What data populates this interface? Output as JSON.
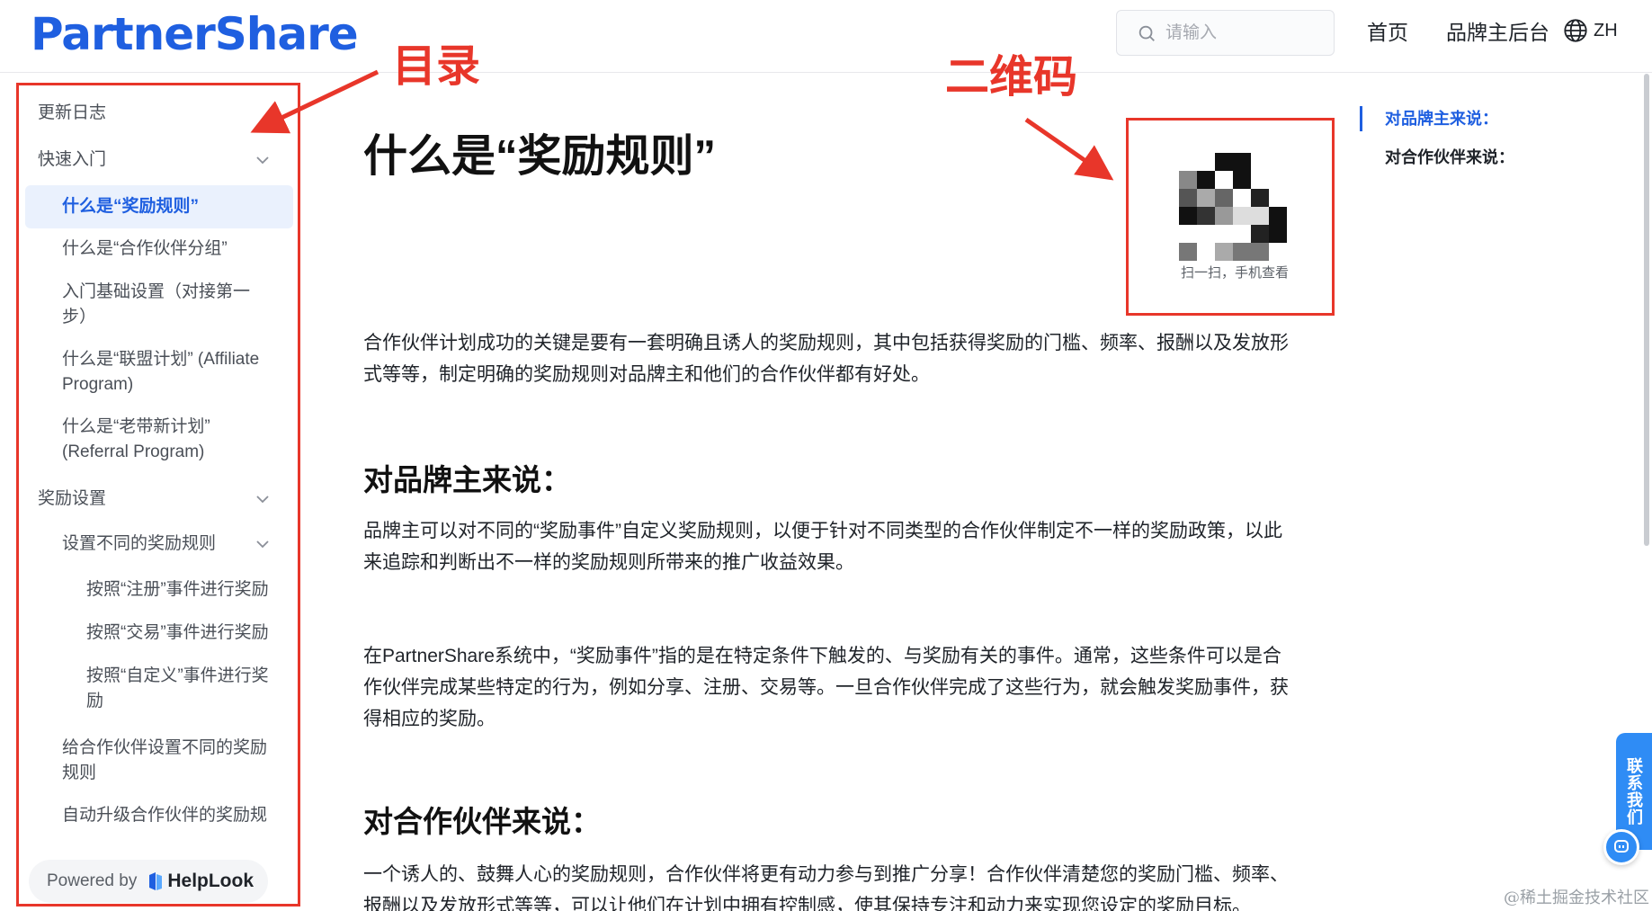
{
  "header": {
    "logo": "PartnerShare",
    "search_placeholder": "请输入",
    "nav": [
      "首页",
      "品牌主后台"
    ],
    "lang": "ZH"
  },
  "sidebar": {
    "items": [
      "更新日志",
      "快速入门",
      "什么是“奖励规则”",
      "什么是“合作伙伴分组”",
      "入门基础设置（对接第一步）",
      "什么是“联盟计划” (Affiliate Program)",
      "什么是“老带新计划” (Referral Program)",
      "奖励设置",
      "设置不同的奖励规则",
      "按照“注册”事件进行奖励",
      "按照“交易”事件进行奖励",
      "按照“自定义”事件进行奖励",
      "给合作伙伴设置不同的奖励规则",
      "自动升级合作伙伴的奖励规则"
    ],
    "active_index": 2,
    "powered_by": "Powered by",
    "powered_brand": "HelpLook"
  },
  "annotations": {
    "toc_label": "目录",
    "qr_label": "二维码"
  },
  "main": {
    "title": "什么是“奖励规则”",
    "qr_caption": "扫一扫，手机查看",
    "intro": "合作伙伴计划成功的关键是要有一套明确且诱人的奖励规则，其中包括获得奖励的门槛、频率、报酬以及发放形式等等，制定明确的奖励规则对品牌主和他们的合作伙伴都有好处。",
    "section1_heading": "对品牌主来说：",
    "section1_p1": "品牌主可以对不同的“奖励事件”自定义奖励规则，以便于针对不同类型的合作伙伴制定不一样的奖励政策，以此来追踪和判断出不一样的奖励规则所带来的推广收益效果。",
    "section1_p2": "在PartnerShare系统中，“奖励事件”指的是在特定条件下触发的、与奖励有关的事件。通常，这些条件可以是合作伙伴完成某些特定的行为，例如分享、注册、交易等。一旦合作伙伴完成了这些行为，就会触发奖励事件，获得相应的奖励。",
    "section2_heading": "对合作伙伴来说：",
    "section2_p1": "一个诱人的、鼓舞人心的奖励规则，合作伙伴将更有动力参与到推广分享！合作伙伴清楚您的奖励门槛、频率、报酬以及发放形式等等，可以让他们在计划中拥有控制感，使其保持专注和动力来实现您设定的奖励目标。"
  },
  "toc": {
    "items": [
      "对品牌主来说：",
      "对合作伙伴来说："
    ],
    "active_index": 0
  },
  "widgets": {
    "contact": "联系我们",
    "watermark": "@稀土掘金技术社区"
  },
  "colors": {
    "brand": "#1f5fe0",
    "annotation_red": "#e8362a",
    "active_bg": "#eaf1fd",
    "contact_blue": "#2f8cf5"
  }
}
